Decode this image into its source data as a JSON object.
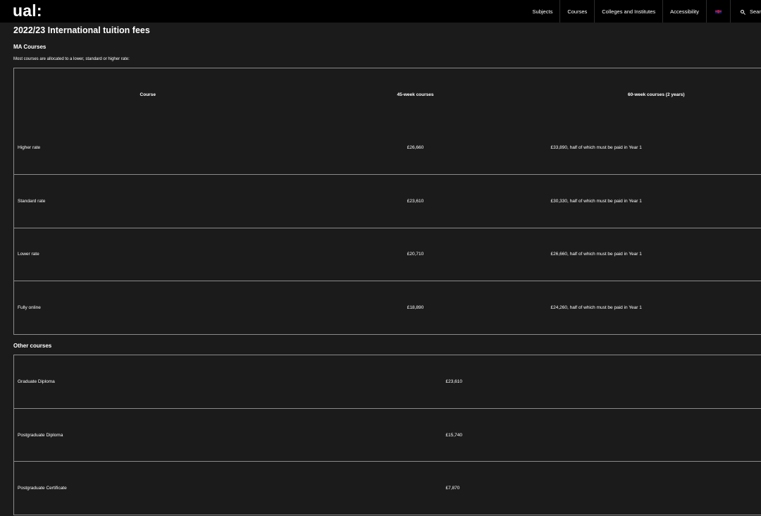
{
  "header": {
    "logo": "ual:",
    "nav": [
      {
        "label": "Subjects"
      },
      {
        "label": "Courses"
      },
      {
        "label": "Colleges and Institutes"
      },
      {
        "label": "Accessibility"
      }
    ],
    "language_icon": "uk-flag-icon",
    "search_label": "Sear",
    "search_icon": "search-icon"
  },
  "page_title": "2022/23 International tuition fees",
  "ma_section": {
    "heading": "MA Courses",
    "intro": "Most courses are allocated to a lower, standard or higher rate:",
    "columns": [
      "Course",
      "45-week courses",
      "60-week courses (2 years)"
    ],
    "rows": [
      {
        "course": "Higher rate",
        "fee_45": "£26,660",
        "fee_60": "£33,890, half of which must be paid in Year 1"
      },
      {
        "course": "Standard rate",
        "fee_45": "£23,610",
        "fee_60": "£30,330, half of which must be paid in Year 1"
      },
      {
        "course": "Lower rate",
        "fee_45": "£20,710",
        "fee_60": "£26,660, half of which must be paid in Year 1"
      },
      {
        "course": "Fully online",
        "fee_45": "£18,890",
        "fee_60": "£24,260, half of which must be paid in Year 1"
      }
    ]
  },
  "other_section": {
    "heading": "Other courses",
    "rows": [
      {
        "course": "Graduate Diploma",
        "fee": "£23,610"
      },
      {
        "course": "Postgraduate Diploma",
        "fee": "£15,740"
      },
      {
        "course": "Postgraduate Certificate",
        "fee": "£7,870"
      }
    ]
  },
  "colors": {
    "background": "#1b1b1b",
    "header_background": "#000000",
    "border": "#8a8a8a",
    "text": "#ffffff"
  }
}
